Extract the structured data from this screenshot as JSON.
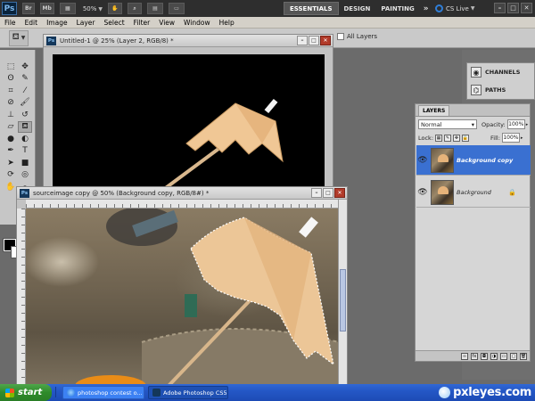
{
  "topbar": {
    "logo": "Ps",
    "br_label": "Br",
    "mb_label": "Mb",
    "zoom": "50%",
    "workspaces": [
      "ESSENTIALS",
      "DESIGN",
      "PAINTING"
    ],
    "more": "»",
    "cs_live": "CS Live",
    "window_controls": [
      "–",
      "□",
      "✕"
    ]
  },
  "menu": [
    "File",
    "Edit",
    "Image",
    "Layer",
    "Select",
    "Filter",
    "View",
    "Window",
    "Help"
  ],
  "options_bar": {
    "all_layers_label": "All Layers"
  },
  "documents": {
    "doc1_title": "Untitled-1 @ 25% (Layer 2, RGB/8) *",
    "doc2_title": "sourceimage copy @ 50% (Background copy, RGB/8#) *",
    "doc_icon": "Ps",
    "controls": [
      "–",
      "□",
      "✕"
    ]
  },
  "mini_panels": {
    "channels": "CHANNELS",
    "paths": "PATHS"
  },
  "layers_panel": {
    "tab": "LAYERS",
    "blend_mode": "Normal",
    "opacity_label": "Opacity:",
    "opacity": "100%",
    "lock_label": "Lock:",
    "fill_label": "Fill:",
    "fill": "100%",
    "layers": [
      {
        "name": "Background copy",
        "selected": true
      },
      {
        "name": "Background",
        "selected": false
      }
    ]
  },
  "taskbar": {
    "start": "start",
    "tasks": [
      "photoshop contest o...",
      "Adobe Photoshop CS5"
    ],
    "watermark": "pxleyes.com"
  },
  "colors": {
    "accent_selected_layer": "#3a70d1",
    "close_button": "#b23b2a",
    "taskbar": "#2457c6"
  }
}
